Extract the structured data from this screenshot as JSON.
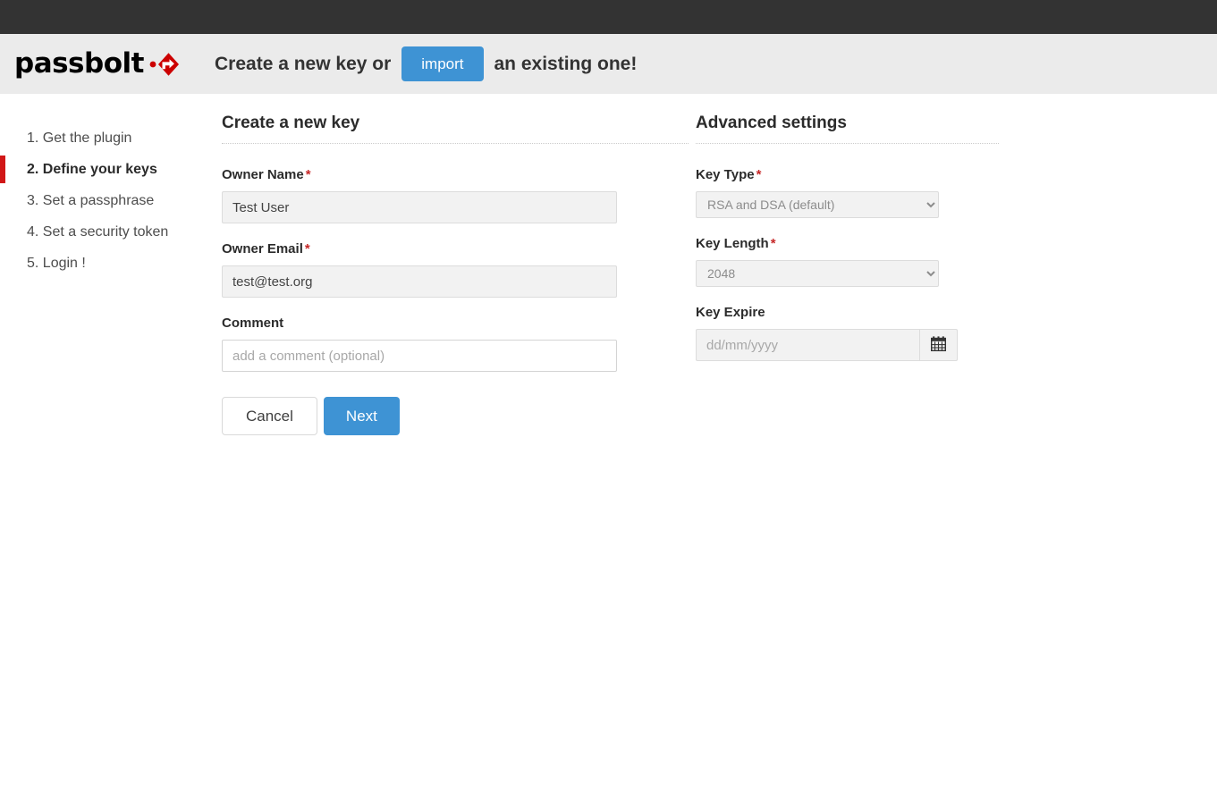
{
  "colors": {
    "top_bar": "#333333",
    "header_bg": "#ebebeb",
    "accent_blue": "#3e93d4",
    "accent_red": "#d11717",
    "required_red": "#c62828"
  },
  "header": {
    "logo_text": "passbolt",
    "title_left": "Create a new key or",
    "import_label": "import",
    "title_right": "an existing one!"
  },
  "sidebar": {
    "items": [
      {
        "label": "1. Get the plugin",
        "active": false
      },
      {
        "label": "2. Define your keys",
        "active": true
      },
      {
        "label": "3. Set a passphrase",
        "active": false
      },
      {
        "label": "4. Set a security token",
        "active": false
      },
      {
        "label": "5. Login !",
        "active": false
      }
    ]
  },
  "create_key": {
    "title": "Create a new key",
    "owner_name": {
      "label": "Owner Name",
      "required_mark": "*",
      "value": "Test User",
      "placeholder": ""
    },
    "owner_email": {
      "label": "Owner Email",
      "required_mark": "*",
      "value": "test@test.org",
      "placeholder": ""
    },
    "comment": {
      "label": "Comment",
      "value": "",
      "placeholder": "add a comment (optional)"
    },
    "cancel_label": "Cancel",
    "next_label": "Next"
  },
  "advanced": {
    "title": "Advanced settings",
    "key_type": {
      "label": "Key Type",
      "required_mark": "*",
      "selected": "RSA and DSA (default)",
      "options": [
        "RSA and DSA (default)"
      ]
    },
    "key_length": {
      "label": "Key Length",
      "required_mark": "*",
      "selected": "2048",
      "options": [
        "2048"
      ]
    },
    "key_expire": {
      "label": "Key Expire",
      "value": "",
      "placeholder": "dd/mm/yyyy",
      "calendar_icon": "calendar-icon"
    }
  }
}
